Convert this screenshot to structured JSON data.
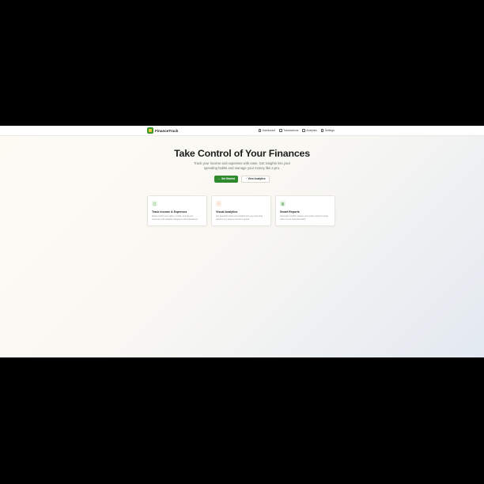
{
  "app": {
    "name": "FinanceTrack"
  },
  "nav": {
    "items": [
      {
        "label": "Dashboard",
        "icon": "home-icon"
      },
      {
        "label": "Transactions",
        "icon": "list-icon"
      },
      {
        "label": "Analytics",
        "icon": "chart-icon"
      },
      {
        "label": "Settings",
        "icon": "gear-icon"
      }
    ]
  },
  "hero": {
    "title": "Take Control of Your Finances",
    "subtitle": "Track your income and expenses with ease. Get insights into your spending habits and manage your money like a pro.",
    "primary_button": "Get Started",
    "secondary_button": "View Analytics"
  },
  "features": [
    {
      "title": "Track Income & Expenses",
      "description": "Easily record your salary, rentals, and all your expenses with detailed categories and timestamps.",
      "icon": "wallet-icon",
      "icon_color": "#2f8a2e",
      "icon_bg": "#e6f4e3"
    },
    {
      "title": "Visual Analytics",
      "description": "Get beautiful charts and insights into your spending patterns by category and time period.",
      "icon": "pie-chart-icon",
      "icon_color": "#e07a3c",
      "icon_bg": "#fdeee3"
    },
    {
      "title": "Smart Reports",
      "description": "Generate monthly, weekly, and yearly reports to keep track of your financial health.",
      "icon": "bar-chart-icon",
      "icon_color": "#2f8a2e",
      "icon_bg": "#e6f4e3"
    }
  ],
  "colors": {
    "accent": "#2f8a2e",
    "brand_yellow": "#f3c93a"
  }
}
